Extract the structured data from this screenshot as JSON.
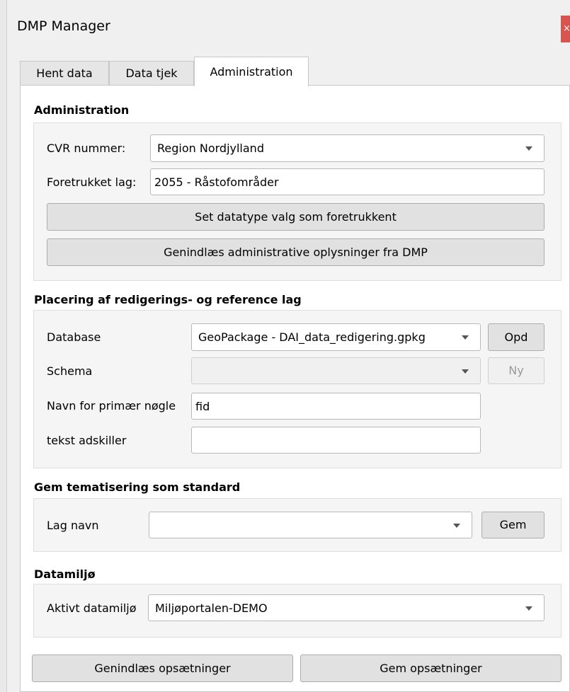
{
  "window": {
    "title": "DMP Manager",
    "close_glyph": "×"
  },
  "tabs": [
    {
      "label": "Hent data",
      "active": false
    },
    {
      "label": "Data tjek",
      "active": false
    },
    {
      "label": "Administration",
      "active": true
    }
  ],
  "administration": {
    "heading": "Administration",
    "cvr_label": "CVR nummer:",
    "cvr_value": "Region Nordjylland",
    "preferred_layer_label": "Foretrukket lag:",
    "preferred_layer_value": "2055 - Råstofområder",
    "set_preferred_button": "Set datatype valg som foretrukkent",
    "reload_admin_button": "Genindlæs administrative oplysninger fra DMP"
  },
  "placement": {
    "heading": "Placering af redigerings- og reference lag",
    "database_label": "Database",
    "database_value": "GeoPackage - DAI_data_redigering.gpkg",
    "update_button": "Opd",
    "schema_label": "Schema",
    "schema_value": "",
    "new_button": "Ny",
    "primary_key_label": "Navn for primær nøgle",
    "primary_key_value": "fid",
    "text_separator_label": "tekst adskiller",
    "text_separator_value": ""
  },
  "theming": {
    "heading": "Gem tematisering som standard",
    "layer_name_label": "Lag navn",
    "layer_name_value": "",
    "save_button": "Gem"
  },
  "environment": {
    "heading": "Datamiljø",
    "active_label": "Aktivt datamiljø",
    "active_value": "Miljøportalen-DEMO"
  },
  "footer": {
    "reload_settings_button": "Genindlæs opsætninger",
    "save_settings_button": "Gem opsætninger"
  }
}
